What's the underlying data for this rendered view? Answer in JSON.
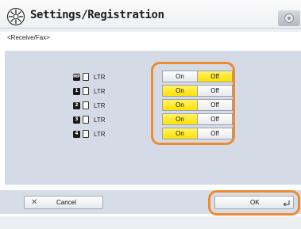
{
  "window": {
    "title": "Settings/Registration",
    "title_icon": "settings-gear-icon",
    "corner_icon": "device-status-icon"
  },
  "breadcrumb": "<Receive/Fax>",
  "drawers": [
    {
      "badge": "MP",
      "paper_icon": "paper-sheet-icon",
      "size": "LTR",
      "on_label": "On",
      "off_label": "Off",
      "selected": "Off"
    },
    {
      "badge": "1",
      "paper_icon": "paper-sheet-icon",
      "size": "LTR",
      "on_label": "On",
      "off_label": "Off",
      "selected": "On"
    },
    {
      "badge": "2",
      "paper_icon": "paper-sheet-icon",
      "size": "LTR",
      "on_label": "On",
      "off_label": "Off",
      "selected": "On"
    },
    {
      "badge": "3",
      "paper_icon": "paper-sheet-icon",
      "size": "LTR",
      "on_label": "On",
      "off_label": "Off",
      "selected": "On"
    },
    {
      "badge": "4",
      "paper_icon": "paper-sheet-icon",
      "size": "LTR",
      "on_label": "On",
      "off_label": "Off",
      "selected": "On"
    }
  ],
  "footer": {
    "cancel_icon": "close-icon",
    "cancel_label": "Cancel",
    "ok_label": "OK",
    "ok_icon": "enter-return-icon"
  },
  "colors": {
    "selected": "#ffe100",
    "highlight": "#ef8a2e",
    "panel": "#d5dbe6"
  }
}
